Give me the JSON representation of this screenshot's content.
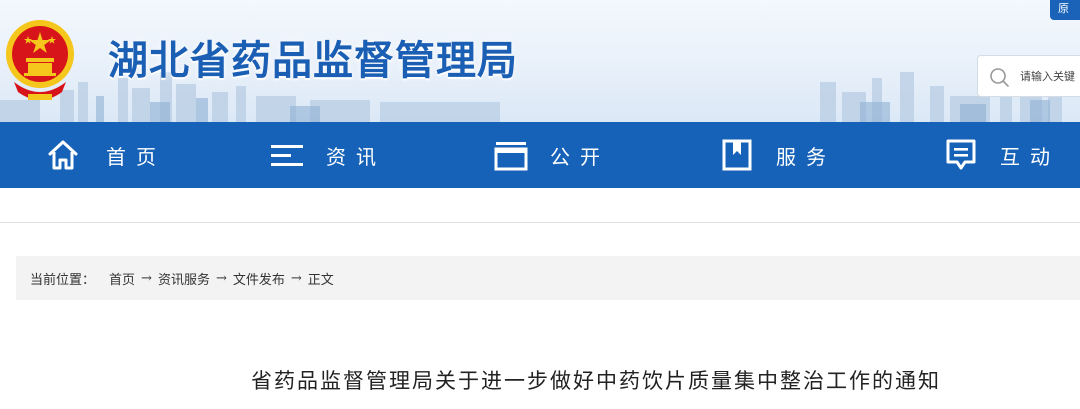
{
  "header": {
    "site_title": "湖北省药品监督管理局",
    "top_button_label": "原",
    "search": {
      "placeholder": "请输入关键"
    }
  },
  "nav": {
    "items": [
      {
        "label": "首页",
        "icon": "home-icon"
      },
      {
        "label": "资讯",
        "icon": "menu-lines-icon"
      },
      {
        "label": "公开",
        "icon": "folder-icon"
      },
      {
        "label": "服务",
        "icon": "bookmark-icon"
      },
      {
        "label": "互动",
        "icon": "chat-icon"
      }
    ]
  },
  "breadcrumb": {
    "label": "当前位置：",
    "items": [
      "首页",
      "资讯服务",
      "文件发布",
      "正文"
    ],
    "separator": "→"
  },
  "article": {
    "title": "省药品监督管理局关于进一步做好中药饮片质量集中整治工作的通知"
  },
  "colors": {
    "brand_blue": "#1662b8",
    "title_blue": "#1a5fb4",
    "emblem_red": "#d7141a",
    "emblem_gold": "#f5c61b"
  }
}
